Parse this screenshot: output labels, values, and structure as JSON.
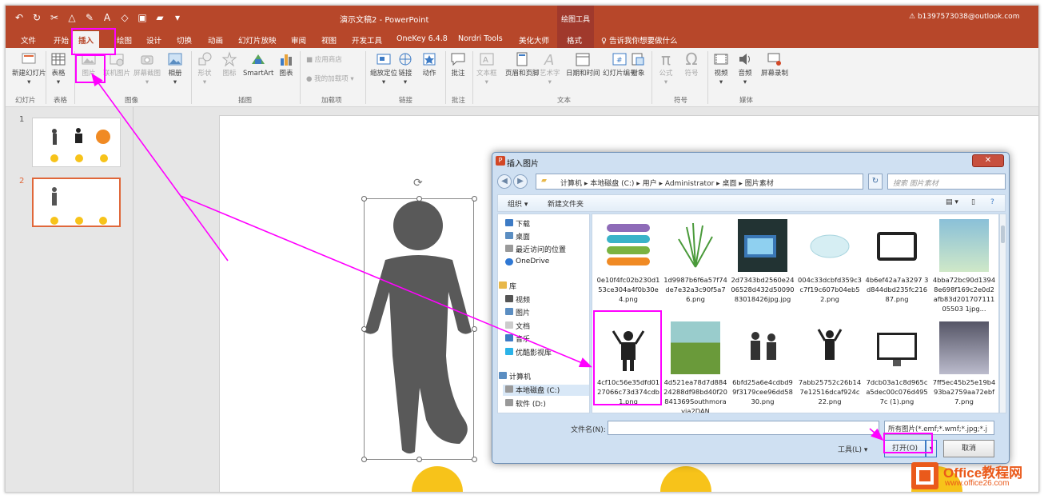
{
  "titlebar": {
    "document_title": "演示文稿2 - PowerPoint",
    "context_group": "绘图工具",
    "account": "b1397573038@outlook.com",
    "accent_color": "#b7472a"
  },
  "tabs": [
    "文件",
    "开始",
    "插入",
    "绘图",
    "设计",
    "切换",
    "动画",
    "幻灯片放映",
    "审阅",
    "视图",
    "开发工具",
    "OneKey 6.4.8",
    "Nordri Tools",
    "美化大师",
    "格式",
    "告诉我你想要做什么"
  ],
  "active_tab": "插入",
  "ribbon": {
    "buttons": [
      "新建幻灯片",
      "表格",
      "图片",
      "联机图片",
      "屏幕截图",
      "相册",
      "形状",
      "图标",
      "SmartArt",
      "图表",
      "应用商店",
      "我的加载项",
      "缩放定位",
      "链接",
      "动作",
      "批注",
      "文本框",
      "页眉和页脚",
      "艺术字",
      "日期和时间",
      "幻灯片编号",
      "对象",
      "公式",
      "符号",
      "视频",
      "音频",
      "屏幕录制"
    ],
    "groups": [
      "幻灯片",
      "表格",
      "图像",
      "插图",
      "加载项",
      "链接",
      "批注",
      "文本",
      "符号",
      "媒体"
    ]
  },
  "slides": {
    "numbers": [
      "1",
      "2"
    ],
    "selected": 2
  },
  "dialog": {
    "title": "插入图片",
    "address": "计算机 ▸ 本地磁盘 (C:) ▸ 用户 ▸ Administrator ▸ 桌面 ▸ 图片素材",
    "search_placeholder": "搜索 图片素材",
    "toolbar": {
      "organize": "组织 ▾",
      "new_folder": "新建文件夹"
    },
    "nav_items": [
      "下载",
      "桌面",
      "最近访问的位置",
      "OneDrive",
      "库",
      "视频",
      "图片",
      "文档",
      "音乐",
      "优酷影视库",
      "计算机",
      "本地磁盘 (C:)",
      "软件 (D:)"
    ],
    "files": [
      "0e10f4fc02b230d153ce304a4f0b30e4.png",
      "1d9987b6f6a57f74de7e32a3c90f5a76.png",
      "2d7343bd2560e2406528d432d5009083018426jpg.jpg",
      "004c33dcbfd359c3c7f19c607b04eb52.png",
      "4b6ef42a7a3297 3d844dbd235fc21687.png",
      "4bba72bc90d13948e698f169c2e0d2afb83d20170711105503 1jpg...",
      "4cf10c56e35dfd0127066c73d374cdb1.png",
      "4d521ea78d7d88424288df98bd40f20841369Southmoravia2DAN",
      "6bfd25a6e4cdbd99f3179cee96dd5830.png",
      "7abb25752c26b147e12516dcaf924c22.png",
      "7dcb03a1c8d965ca5dec00c076d4957c (1).png",
      "7ff5ec45b25e19b493ba2759aa72ebf7.png"
    ],
    "filename_label": "文件名(N):",
    "filename_value": "",
    "filetype": "所有图片(*.emf;*.wmf;*.jpg;*.j",
    "tools": "工具(L)  ▾",
    "open": "打开(O)",
    "cancel": "取消"
  },
  "watermark": {
    "brand": "Office教程网",
    "url": "www.office26.com"
  },
  "highlight_color": "#ff00ff"
}
